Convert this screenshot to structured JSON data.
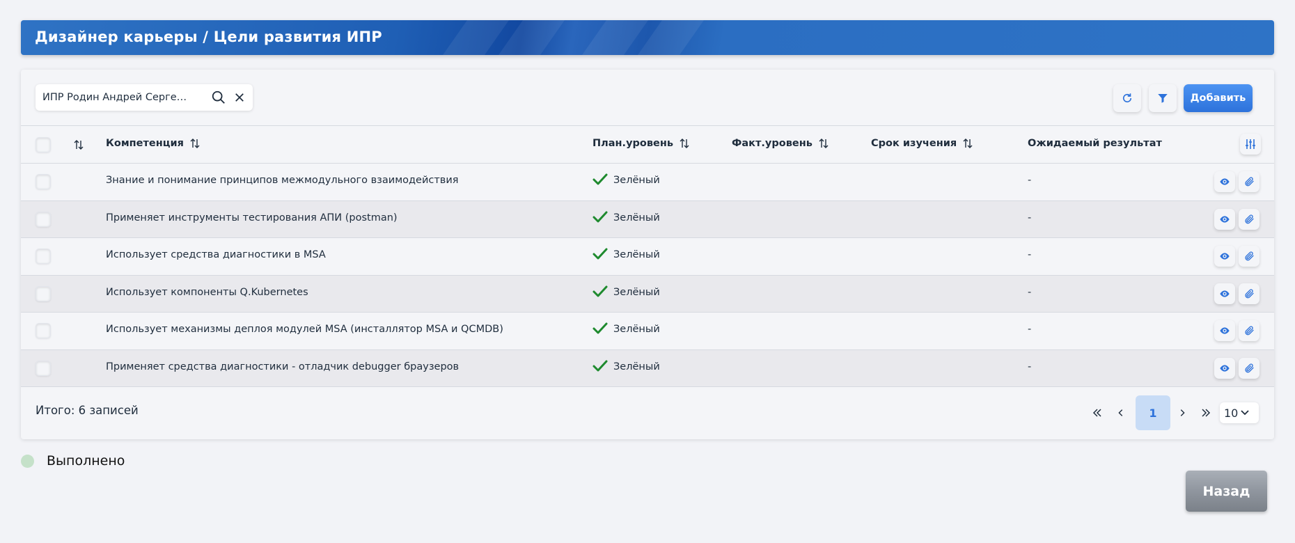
{
  "header": {
    "title": "Дизайнер карьеры / Цели развития ИПР"
  },
  "toolbar": {
    "search_value": "ИПР Родин Андрей Сергее...",
    "add_label": "Добавить"
  },
  "table": {
    "columns": {
      "competency": "Компетенция",
      "plan_level": "План.уровень",
      "fact_level": "Факт.уровень",
      "study_term": "Срок изучения",
      "expected_result": "Ожидаемый результат"
    },
    "rows": [
      {
        "competency": "Знание и понимание принципов межмодульного взаимодействия",
        "plan_level": "Зелёный",
        "fact_level": "",
        "study_term": "",
        "expected_result": "-"
      },
      {
        "competency": "Применяет инструменты тестирования АПИ (postman)",
        "plan_level": "Зелёный",
        "fact_level": "",
        "study_term": "",
        "expected_result": "-"
      },
      {
        "competency": "Использует средства диагностики в MSA",
        "plan_level": "Зелёный",
        "fact_level": "",
        "study_term": "",
        "expected_result": "-"
      },
      {
        "competency": "Использует компоненты Q.Kubernetes",
        "plan_level": "Зелёный",
        "fact_level": "",
        "study_term": "",
        "expected_result": "-"
      },
      {
        "competency": "Использует механизмы деплоя модулей MSA (инсталлятор MSA и QCMDB)",
        "plan_level": "Зелёный",
        "fact_level": "",
        "study_term": "",
        "expected_result": "-"
      },
      {
        "competency": "Применяет средства диагностики - отладчик debugger браузеров",
        "plan_level": "Зелёный",
        "fact_level": "",
        "study_term": "",
        "expected_result": "-"
      }
    ]
  },
  "footer": {
    "total": "Итого: 6 записей",
    "current_page": "1",
    "per_page": "10"
  },
  "legend": {
    "label": "Выполнено"
  },
  "back_label": "Назад",
  "colors": {
    "accent": "#2d72db",
    "check_green": "#1e8a2e",
    "legend_dot": "#c5e1c9"
  }
}
